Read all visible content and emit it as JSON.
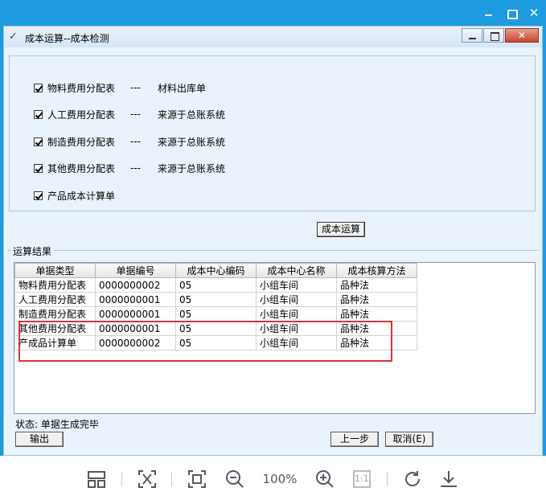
{
  "dialog": {
    "title": "成本运算--成本检测",
    "close_glyph": "✕"
  },
  "checks": [
    {
      "label": "物料费用分配表",
      "sep": "---",
      "source": "材料出库单",
      "checked": true
    },
    {
      "label": "人工费用分配表",
      "sep": "---",
      "source": "来源于总账系统",
      "checked": true
    },
    {
      "label": "制造费用分配表",
      "sep": "---",
      "source": "来源于总账系统",
      "checked": true
    },
    {
      "label": "其他费用分配表",
      "sep": "---",
      "source": "来源于总账系统",
      "checked": true
    },
    {
      "label": "产品成本计算单",
      "sep": "",
      "source": "",
      "checked": true
    }
  ],
  "run_button": "成本运算",
  "results": {
    "legend": "运算结果",
    "columns": [
      "单据类型",
      "单据编号",
      "成本中心编码",
      "成本中心名称",
      "成本核算方法"
    ],
    "rows": [
      [
        "物料费用分配表",
        "0000000002",
        "05",
        "小组车间",
        "品种法"
      ],
      [
        "人工费用分配表",
        "0000000001",
        "05",
        "小组车间",
        "品种法"
      ],
      [
        "制造费用分配表",
        "0000000001",
        "05",
        "小组车间",
        "品种法"
      ],
      [
        "其他费用分配表",
        "0000000001",
        "05",
        "小组车间",
        "品种法"
      ],
      [
        "产成品计算单",
        "0000000002",
        "05",
        "小组车间",
        "品种法"
      ]
    ]
  },
  "status": "状态:  单据生成完毕",
  "buttons": {
    "export": "输出",
    "prev": "上一步",
    "cancel": "取消(E)"
  },
  "toolbar": {
    "zoom": "100%",
    "actual_size": "1:1"
  },
  "colors": {
    "titlebar": "#1e9ae0",
    "highlight": "#e0303a"
  }
}
